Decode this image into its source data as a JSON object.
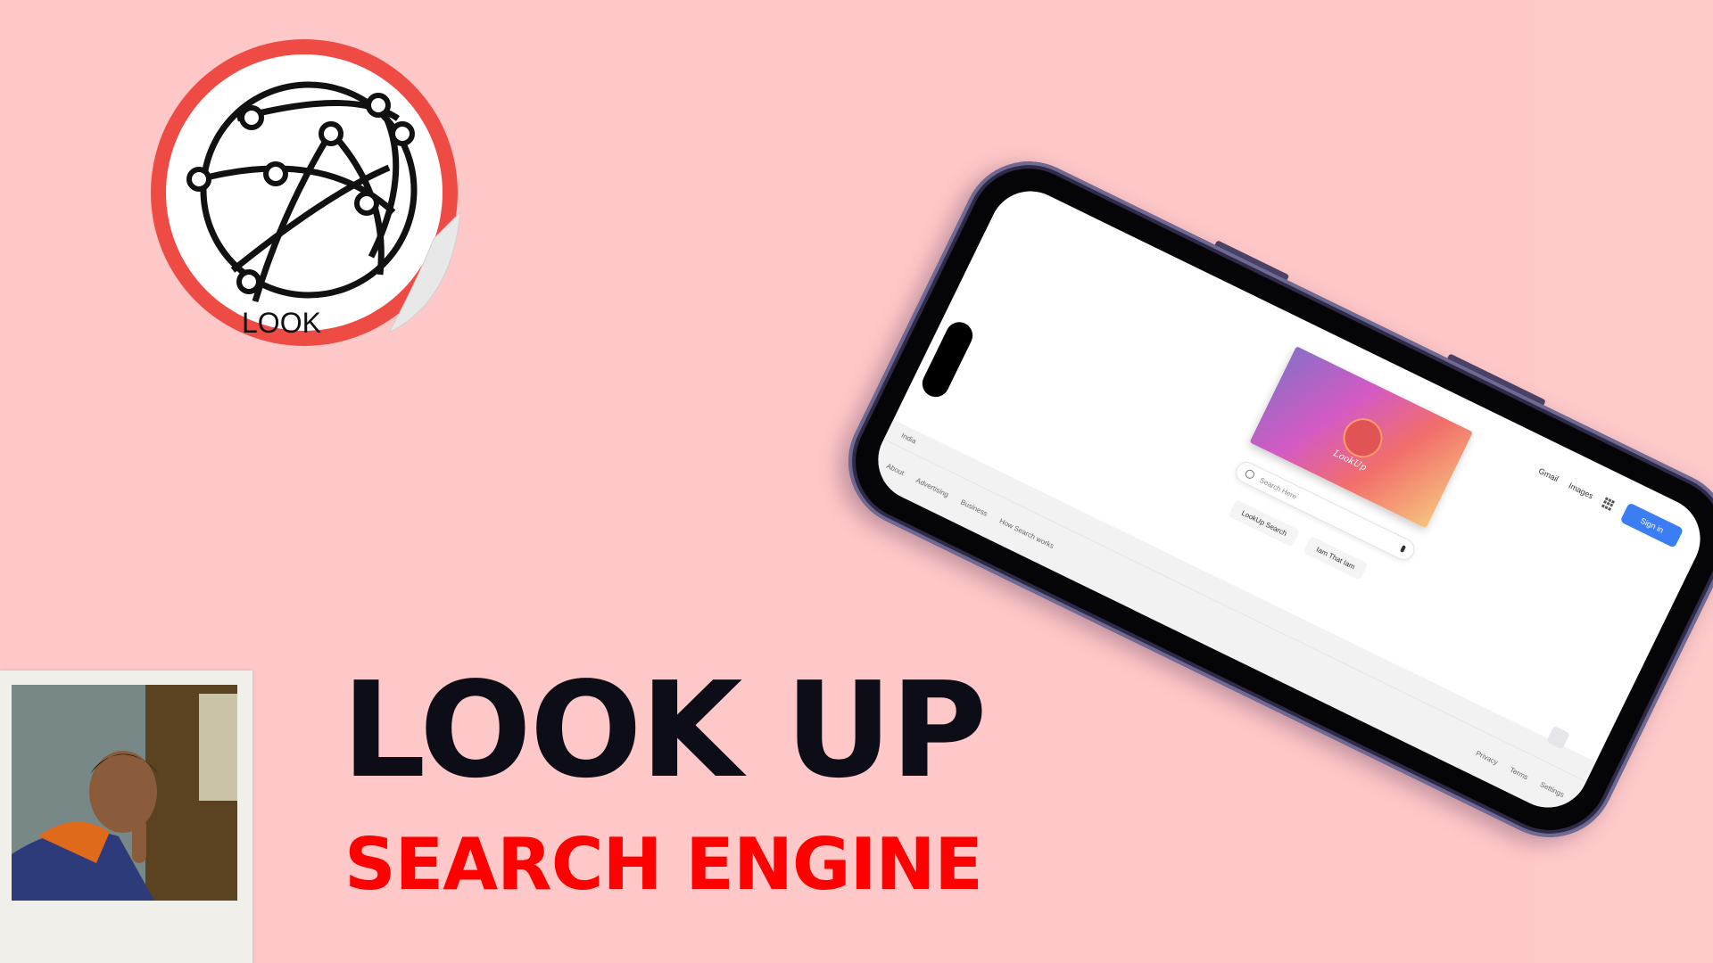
{
  "hero": {
    "title": "LOOK UP",
    "subtitle": "SEARCH ENGINE"
  },
  "sticker": {
    "text": "LOOK",
    "icon": "globe-network-icon",
    "ring_color": "#ee4b45"
  },
  "phone_screen": {
    "nav": {
      "gmail": "Gmail",
      "images": "Images",
      "apps_icon": "apps-grid-icon",
      "signin": "Sign in"
    },
    "banner": {
      "logo_text": "LookUp"
    },
    "search": {
      "placeholder": "Search Here",
      "search_icon": "search-icon",
      "mic_icon": "microphone-icon"
    },
    "buttons": {
      "search": "LookUp Search",
      "lucky": "Iam That Iam"
    },
    "footer": {
      "region": "India",
      "left_links": [
        "About",
        "Advertising",
        "Business",
        "How Search works"
      ],
      "right_links": [
        "Privacy",
        "Terms",
        "Settings"
      ]
    }
  },
  "colors": {
    "background": "#ffc8c8",
    "title": "#0c0d17",
    "subtitle": "#ff0000",
    "phone_frame": "#2e2a48",
    "signin_button": "#3b7ef4"
  }
}
